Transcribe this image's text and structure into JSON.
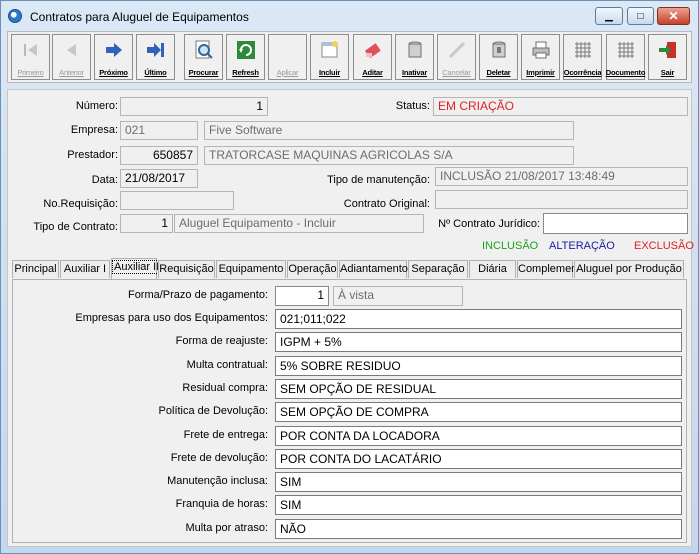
{
  "window": {
    "title": "Contratos para Aluguel de Equipamentos",
    "minimize_symbol": "▁",
    "maximize_symbol": "□",
    "close_symbol": "✕"
  },
  "toolbar": {
    "buttons": [
      {
        "label": "Primeiro",
        "icon": "first-icon",
        "enabled": false
      },
      {
        "label": "Anterior",
        "icon": "previous-icon",
        "enabled": false
      },
      {
        "label": "Próximo",
        "icon": "next-icon",
        "enabled": true
      },
      {
        "label": "Último",
        "icon": "last-icon",
        "enabled": true
      },
      {
        "label": "Procurar",
        "icon": "search-icon",
        "enabled": true
      },
      {
        "label": "Refresh",
        "icon": "refresh-icon",
        "enabled": true
      },
      {
        "label": "Aplicar",
        "icon": "apply-icon",
        "enabled": false
      },
      {
        "label": "Incluir",
        "icon": "new-record-icon",
        "enabled": true
      },
      {
        "label": "Aditar",
        "icon": "edit-icon",
        "enabled": true
      },
      {
        "label": "Inativar",
        "icon": "inactivate-icon",
        "enabled": true
      },
      {
        "label": "Cancelar",
        "icon": "cancel-icon",
        "enabled": false
      },
      {
        "label": "Deletar",
        "icon": "delete-icon",
        "enabled": true
      },
      {
        "label": "Imprimir",
        "icon": "printer-icon",
        "enabled": true
      },
      {
        "label": "Ocorrência",
        "icon": "grid-icon",
        "enabled": true
      },
      {
        "label": "Documento",
        "icon": "grid-icon",
        "enabled": true
      },
      {
        "label": "Sair",
        "icon": "exit-icon",
        "enabled": true
      }
    ]
  },
  "header": {
    "numero_label": "Número:",
    "numero_value": "1",
    "status_label": "Status:",
    "status_value": "EM CRIAÇÃO",
    "empresa_label": "Empresa:",
    "empresa_code": "021",
    "empresa_name": "Five Software",
    "prestador_label": "Prestador:",
    "prestador_code": "650857",
    "prestador_name": "TRATORCASE MAQUINAS AGRICOLAS S/A",
    "data_label": "Data:",
    "data_value": "21/08/2017",
    "tipo_manutencao_label": "Tipo de manutenção:",
    "tipo_manutencao_value": "INCLUSÃO 21/08/2017 13:48:49",
    "norequisicao_label": "No.Requisição:",
    "norequisicao_value": "",
    "contrato_original_label": "Contrato Original:",
    "contrato_original_value": "",
    "tipo_contrato_label": "Tipo de Contrato:",
    "tipo_contrato_code": "1",
    "tipo_contrato_name": "Aluguel Equipamento - Incluir",
    "contrato_juridico_label": "Nº Contrato Jurídico:",
    "contrato_juridico_value": ""
  },
  "legend": {
    "inclusao": "INCLUSÃO",
    "alteracao": "ALTERAÇÃO",
    "exclusao": "EXCLUSÃO",
    "inclusao_color": "#1aa31a",
    "alteracao_color": "#1a1aa3",
    "exclusao_color": "#e02020"
  },
  "tabs": [
    {
      "label": "Principal"
    },
    {
      "label": "Auxiliar I"
    },
    {
      "label": "Auxiliar II"
    },
    {
      "label": "Requisição"
    },
    {
      "label": "Equipamento"
    },
    {
      "label": "Operação"
    },
    {
      "label": "Adiantamento"
    },
    {
      "label": "Separação"
    },
    {
      "label": "Diária"
    },
    {
      "label": "Complemento"
    },
    {
      "label": "Aluguel por Produção"
    }
  ],
  "active_tab": "Auxiliar II",
  "form": {
    "forma_prazo_label": "Forma/Prazo de pagamento:",
    "forma_prazo_code": "1",
    "forma_prazo_desc": "À vista",
    "rows": [
      {
        "label": "Empresas para uso dos Equipamentos:",
        "value": "021;011;022"
      },
      {
        "label": "Forma de reajuste:",
        "value": "IGPM + 5%"
      },
      {
        "label": "Multa contratual:",
        "value": "5% SOBRE RESIDUO"
      },
      {
        "label": "Residual compra:",
        "value": "SEM OPÇÃO DE RESIDUAL"
      },
      {
        "label": "Política de Devolução:",
        "value": "SEM OPÇÃO DE COMPRA"
      },
      {
        "label": "Frete de entrega:",
        "value": "POR CONTA  DA LOCADORA"
      },
      {
        "label": "Frete de devolução:",
        "value": "POR CONTA DO LACATÁRIO"
      },
      {
        "label": "Manutenção inclusa:",
        "value": "SIM"
      },
      {
        "label": "Franquia de horas:",
        "value": "SIM"
      },
      {
        "label": "Multa por atraso:",
        "value": "NÃO"
      }
    ]
  }
}
